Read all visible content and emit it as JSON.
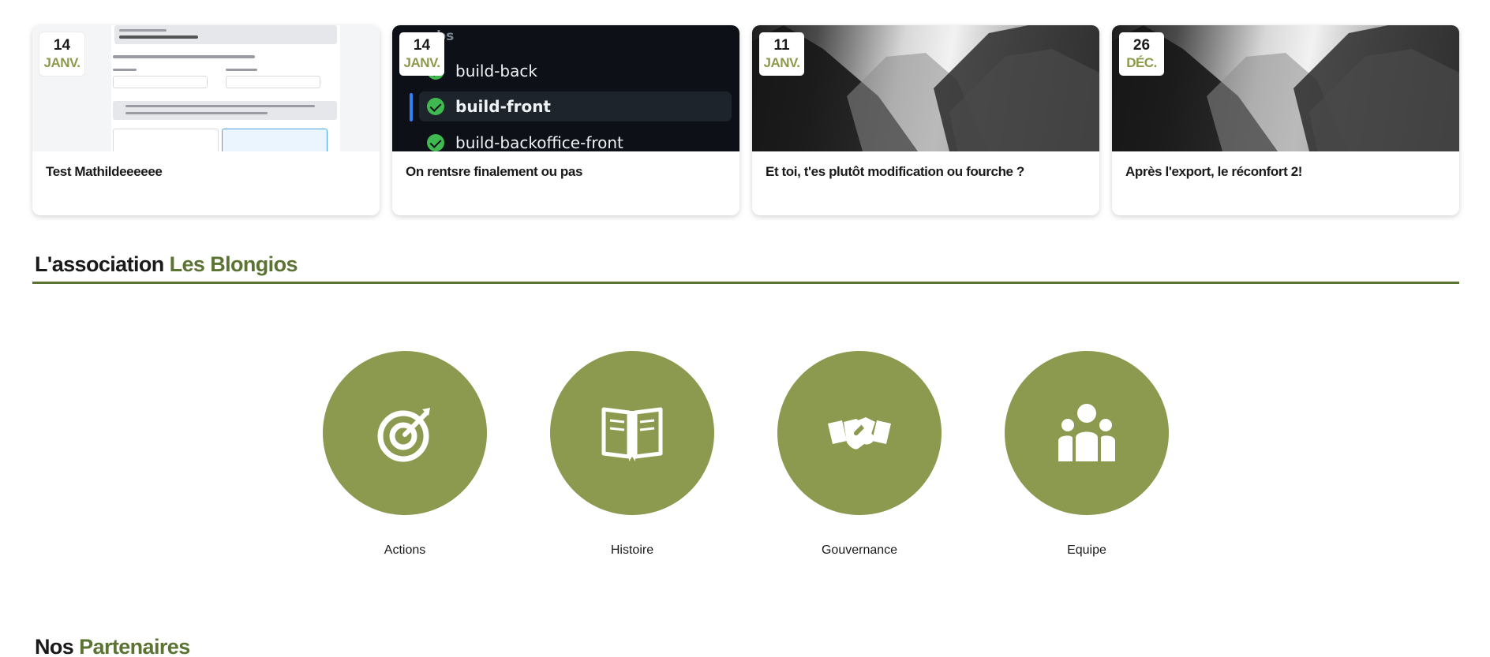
{
  "posts": [
    {
      "day": "14",
      "month": "JANV.",
      "title": "Test Mathildeeeeee"
    },
    {
      "day": "14",
      "month": "JANV.",
      "title": "On rentsre finalement ou pas",
      "thumb_heading": "bs",
      "jobs": [
        "build-back",
        "build-front",
        "build-backoffice-front"
      ]
    },
    {
      "day": "11",
      "month": "JANV.",
      "title": "Et toi, t'es plutôt modification ou fourche ?"
    },
    {
      "day": "26",
      "month": "DÉC.",
      "title": "Après l'export, le réconfort 2!"
    }
  ],
  "association": {
    "heading_prefix": "L'association",
    "heading_accent": "Les Blongios",
    "items": [
      {
        "label": "Actions",
        "icon": "target-icon"
      },
      {
        "label": "Histoire",
        "icon": "book-icon"
      },
      {
        "label": "Gouvernance",
        "icon": "handshake-icon"
      },
      {
        "label": "Equipe",
        "icon": "team-icon"
      }
    ]
  },
  "partners": {
    "heading_prefix": "Nos",
    "heading_accent": "Partenaires"
  },
  "colors": {
    "accent_dark": "#5b7333",
    "accent_olive": "#8b9a4f",
    "month_text": "#8b9a4b"
  }
}
